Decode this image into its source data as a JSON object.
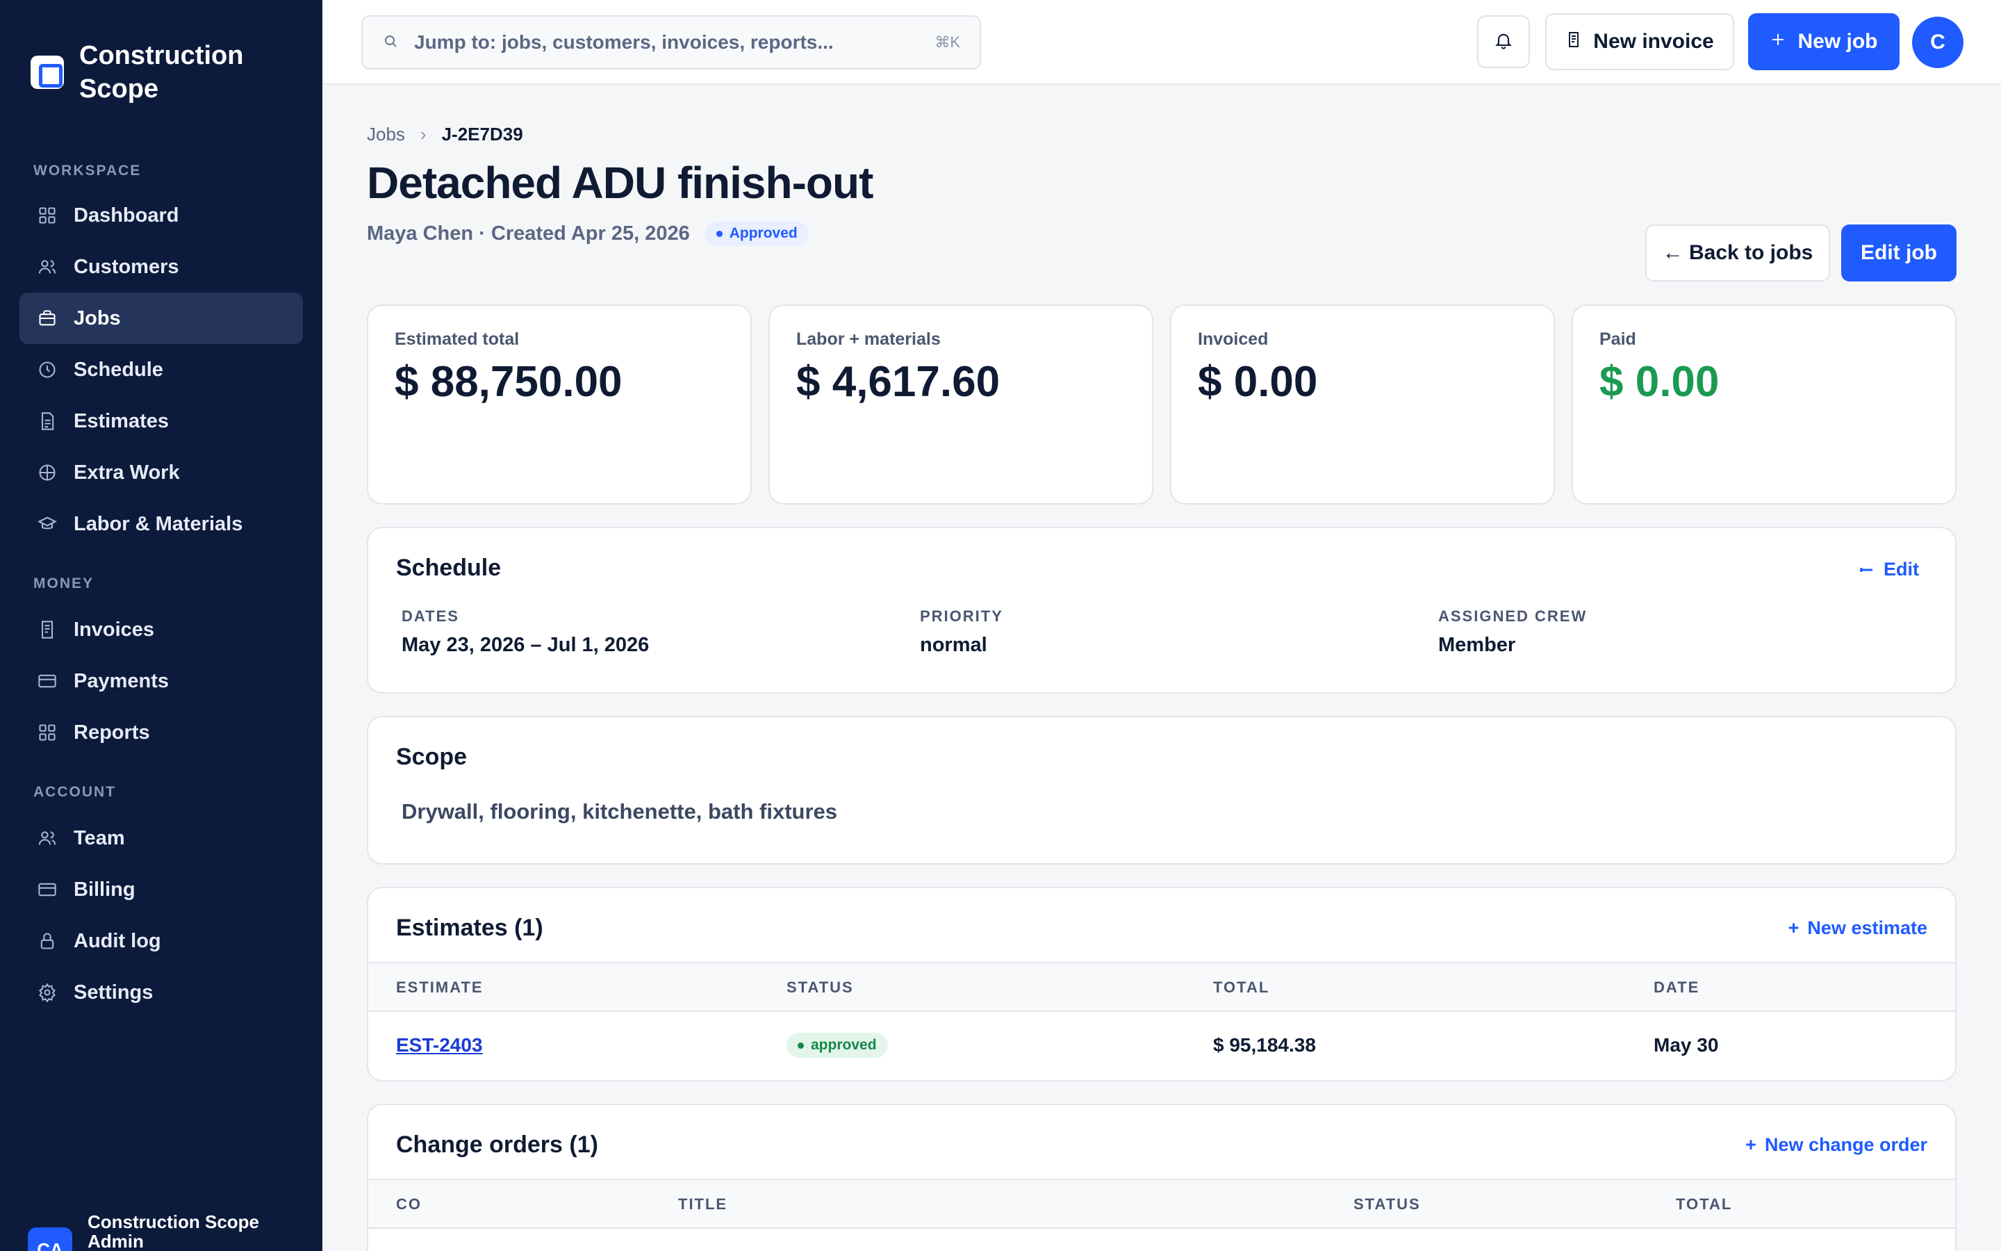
{
  "brand": {
    "name": "Construction Scope"
  },
  "sidebar": {
    "sections": [
      {
        "label": "WORKSPACE"
      },
      {
        "label": "MONEY"
      },
      {
        "label": "ACCOUNT"
      }
    ],
    "items": [
      {
        "label": "Dashboard",
        "icon": "grid-icon"
      },
      {
        "label": "Customers",
        "icon": "users-icon"
      },
      {
        "label": "Jobs",
        "icon": "briefcase-icon",
        "active": true
      },
      {
        "label": "Schedule",
        "icon": "clock-icon"
      },
      {
        "label": "Estimates",
        "icon": "document-icon"
      },
      {
        "label": "Extra Work",
        "icon": "globe-icon"
      },
      {
        "label": "Labor & Materials",
        "icon": "graduation-cap-icon"
      },
      {
        "label": "Invoices",
        "icon": "receipt-icon"
      },
      {
        "label": "Payments",
        "icon": "credit-card-icon"
      },
      {
        "label": "Reports",
        "icon": "grid-icon"
      },
      {
        "label": "Team",
        "icon": "users-icon"
      },
      {
        "label": "Billing",
        "icon": "credit-card-icon"
      },
      {
        "label": "Audit log",
        "icon": "lock-icon"
      },
      {
        "label": "Settings",
        "icon": "gear-icon"
      }
    ],
    "user": {
      "initials": "CA",
      "name": "Construction Scope Admin"
    }
  },
  "topbar": {
    "search_placeholder": "Jump to: jobs, customers, invoices, reports...",
    "search_shortcut": "⌘K",
    "new_invoice_label": "New invoice",
    "new_job_label": "New job",
    "avatar_initial": "C"
  },
  "breadcrumb": {
    "parent": "Jobs",
    "current": "J-2E7D39"
  },
  "job": {
    "title": "Detached ADU finish-out",
    "meta": "Maya Chen · Created Apr 25, 2026",
    "status": "Approved",
    "back_label": "← Back to jobs",
    "edit_label": "Edit job"
  },
  "stats": [
    {
      "label": "Estimated total",
      "value": "$ 88,750.00"
    },
    {
      "label": "Labor + materials",
      "value": "$ 4,617.60"
    },
    {
      "label": "Invoiced",
      "value": "$ 0.00"
    },
    {
      "label": "Paid",
      "value": "$ 0.00"
    }
  ],
  "schedule": {
    "title": "Schedule",
    "edit_label": "Edit",
    "dates_label": "DATES",
    "dates_value": "May 23, 2026 – Jul 1, 2026",
    "priority_label": "PRIORITY",
    "priority_value": "normal",
    "crew_label": "ASSIGNED CREW",
    "crew_value": "Member"
  },
  "scope": {
    "title": "Scope",
    "text": "Drywall, flooring, kitchenette, bath fixtures"
  },
  "estimates": {
    "title": "Estimates (1)",
    "new_label": "New estimate",
    "columns": [
      "ESTIMATE",
      "STATUS",
      "TOTAL",
      "DATE"
    ],
    "rows": [
      {
        "id": "EST-2403",
        "status": "approved",
        "total": "$ 95,184.38",
        "date": "May 30"
      }
    ]
  },
  "change_orders": {
    "title": "Change orders (1)",
    "new_label": "New change order",
    "columns": [
      "CO",
      "TITLE",
      "STATUS",
      "TOTAL"
    ]
  },
  "colors": {
    "sidebar_bg": "#0c1a3b",
    "accent": "#1f5bff",
    "paid_green": "#1a9a52"
  }
}
